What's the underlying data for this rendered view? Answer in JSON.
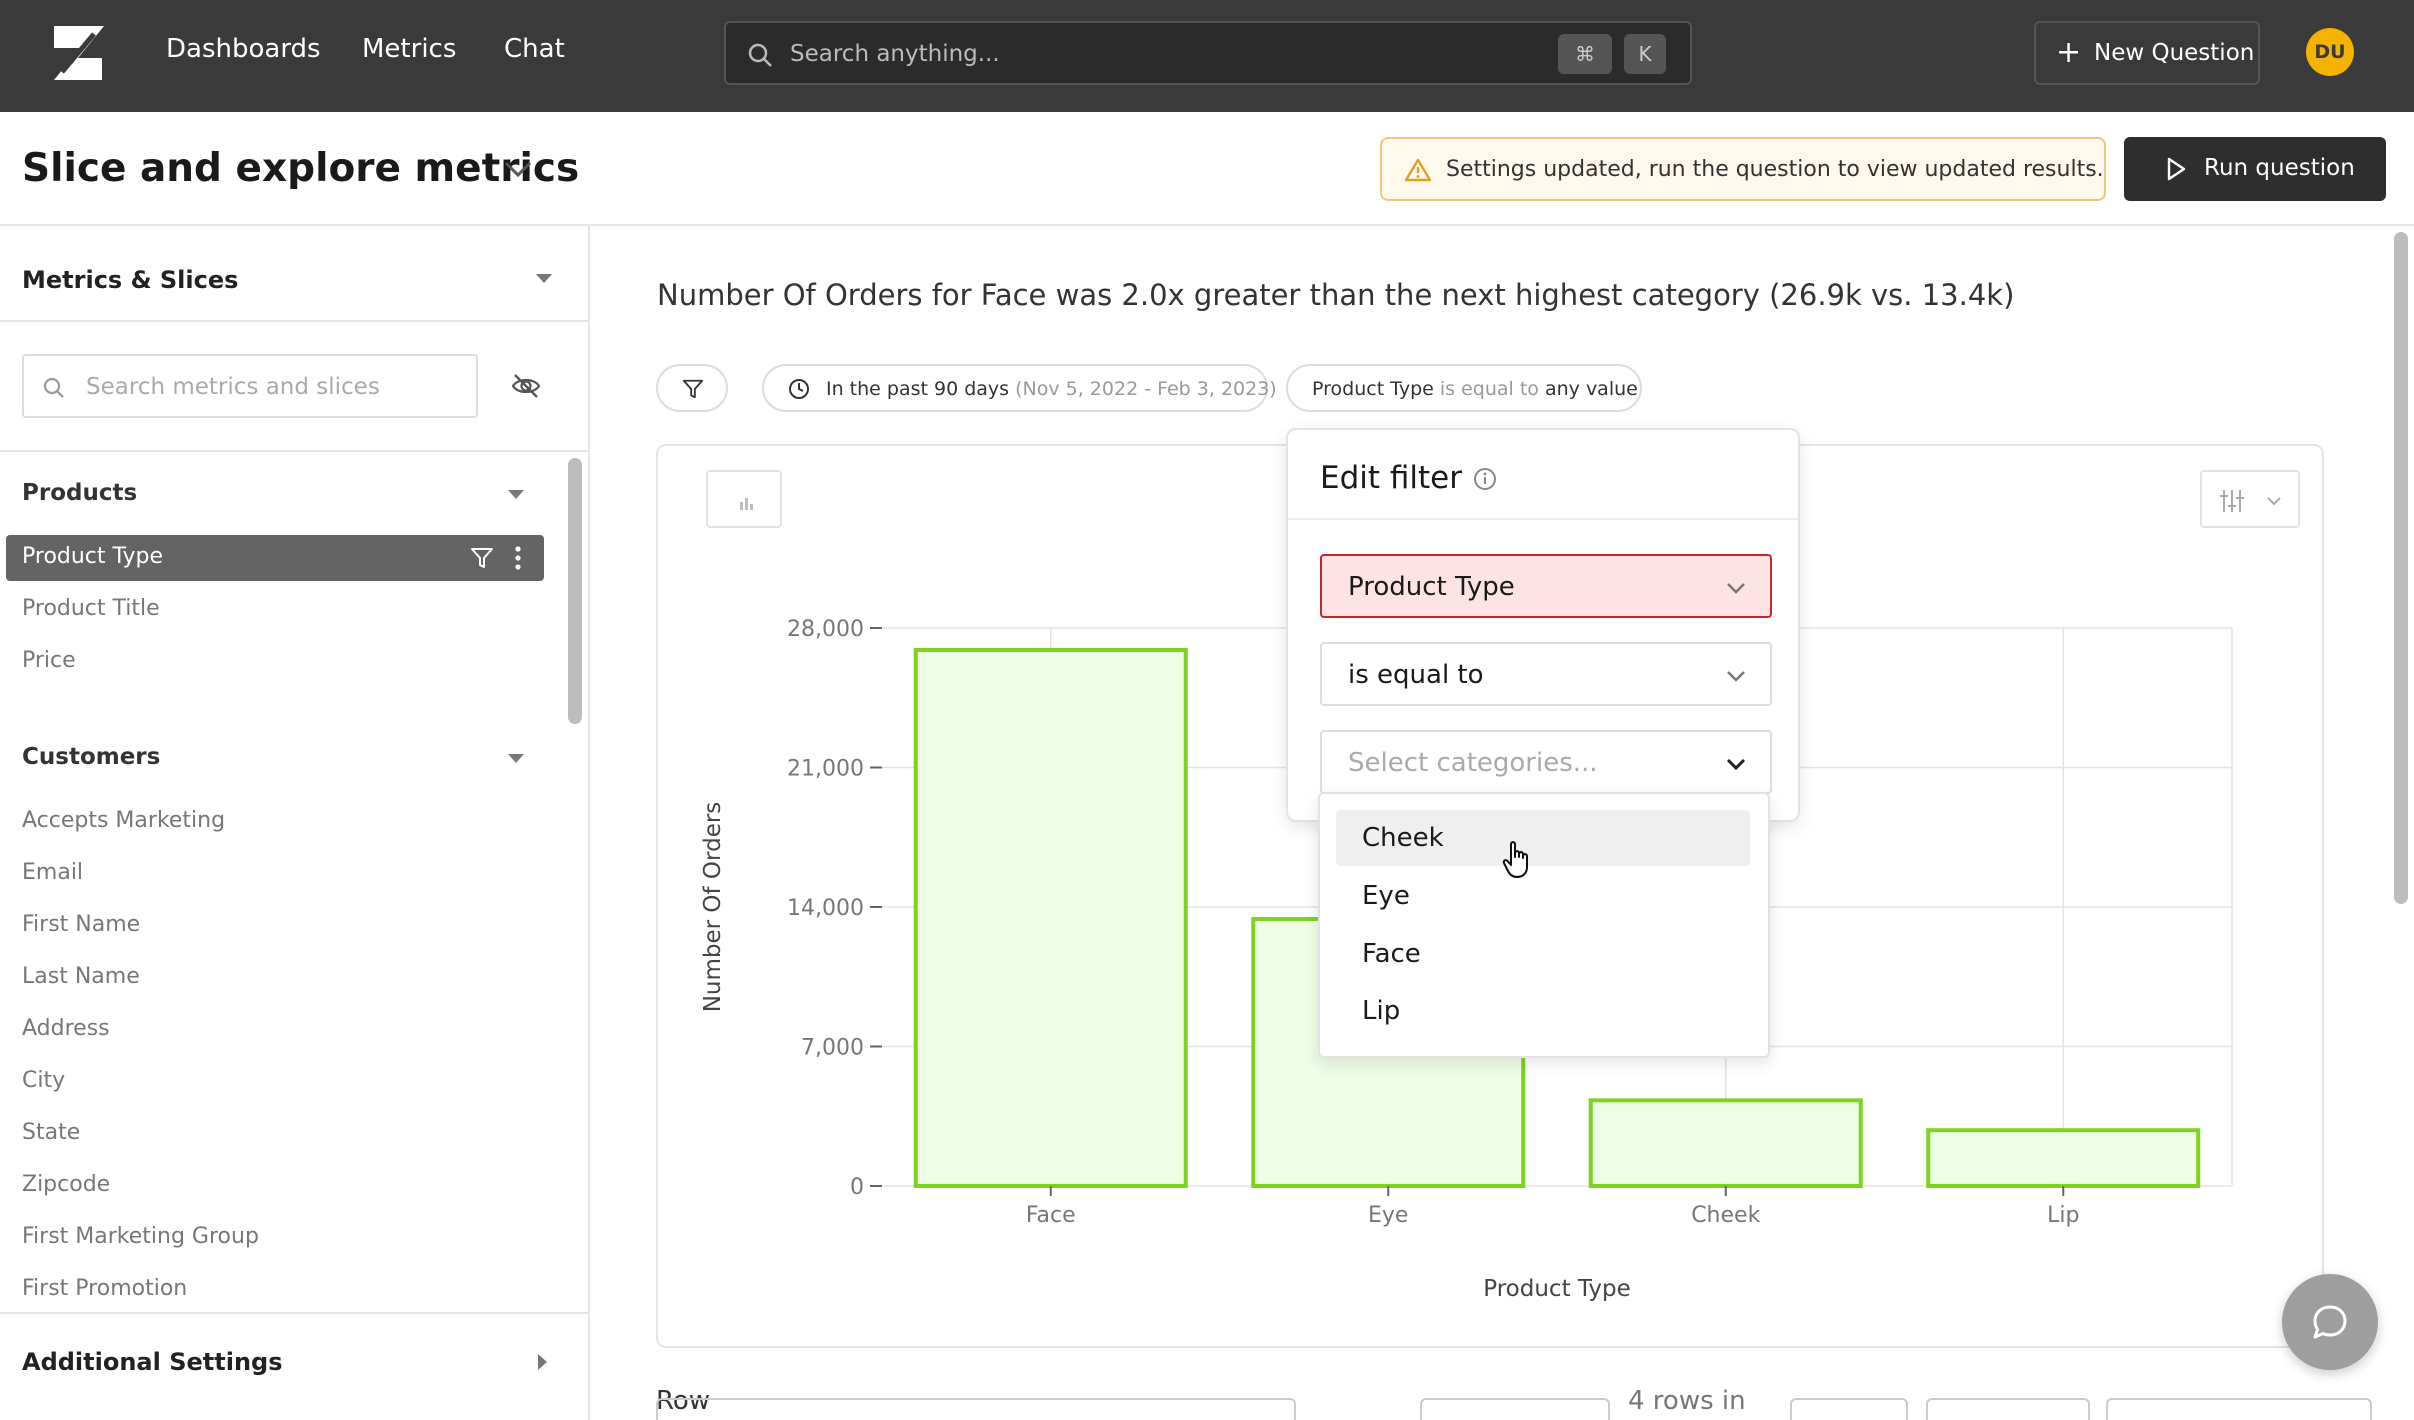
{
  "nav": {
    "links": [
      "Dashboards",
      "Metrics",
      "Chat"
    ],
    "search_placeholder": "Search anything...",
    "shortcut_keys": [
      "⌘",
      "K"
    ],
    "new_question_label": "New Question",
    "avatar_initials": "DU"
  },
  "header": {
    "title": "Slice and explore metrics",
    "banner_text": "Settings updated, run the question to view updated results.",
    "run_label": "Run question"
  },
  "sidebar": {
    "heading": "Metrics & Slices",
    "search_placeholder": "Search metrics and slices",
    "groups": [
      {
        "title": "Products",
        "items": [
          "Product Type",
          "Product Title",
          "Price"
        ],
        "active": "Product Type"
      },
      {
        "title": "Customers",
        "items": [
          "Accepts Marketing",
          "Email",
          "First Name",
          "Last Name",
          "Address",
          "City",
          "State",
          "Zipcode",
          "First Marketing Group",
          "First Promotion"
        ]
      }
    ],
    "additional_settings": "Additional Settings"
  },
  "main": {
    "insight": "Number Of Orders for Face was 2.0x greater than the next highest category (26.9k vs. 13.4k)",
    "date_chip": {
      "label": "In the past 90 days",
      "range": "(Nov 5, 2022 - Feb 3, 2023)"
    },
    "filter_chip": {
      "field": "Product Type",
      "op": "is equal to",
      "value": "any value"
    }
  },
  "popover": {
    "title": "Edit filter",
    "field": "Product Type",
    "operator": "is equal to",
    "categories_placeholder": "Select categories...",
    "options": [
      "Cheek",
      "Eye",
      "Face",
      "Lip"
    ],
    "hovered_option": "Cheek"
  },
  "chart_data": {
    "type": "bar",
    "categories": [
      "Face",
      "Eye",
      "Cheek",
      "Lip"
    ],
    "values": [
      26900,
      13400,
      4300,
      2800
    ],
    "xlabel": "Product Type",
    "ylabel": "Number Of Orders",
    "ylim": [
      0,
      28000
    ],
    "yticks": [
      0,
      7000,
      14000,
      21000,
      28000
    ],
    "ytick_labels": [
      "0",
      "7,000",
      "14,000",
      "21,000",
      "28,000"
    ],
    "bar_fill": "#eefde6",
    "bar_stroke": "#7ed321",
    "grid": true
  },
  "table_strip": {
    "row_label": "Row",
    "rows_text": "4 rows in"
  },
  "colors": {
    "nav_bg": "#3a3a3a",
    "accent_avatar": "#f5b301",
    "error_border": "#c62828",
    "warning_border": "#f2c57c"
  }
}
